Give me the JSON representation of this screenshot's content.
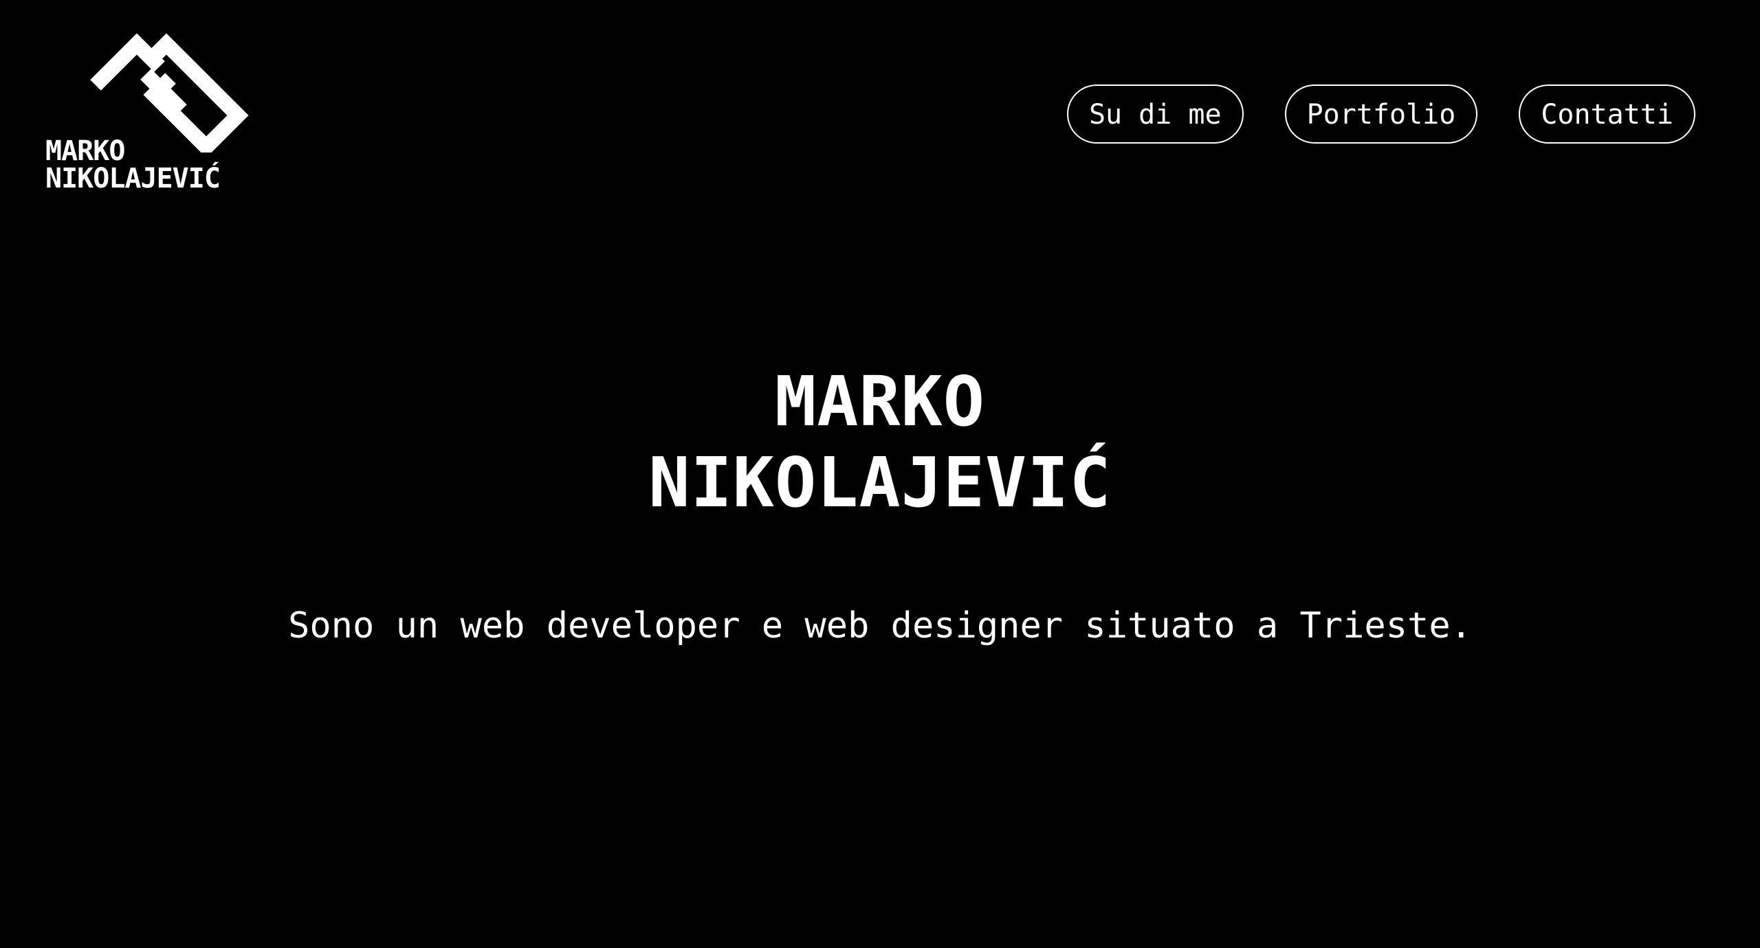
{
  "header": {
    "logo": {
      "line1": "MARKO",
      "line2": "NIKOLAJEVIĆ",
      "icon": "mn-monogram-icon"
    },
    "nav": [
      {
        "label": "Su di me"
      },
      {
        "label": "Portfolio"
      },
      {
        "label": "Contatti"
      }
    ]
  },
  "hero": {
    "title_line1": "MARKO",
    "title_line2": "NIKOLAJEVIĆ",
    "subtitle": "Sono un web developer e web designer situato a Trieste."
  },
  "colors": {
    "background": "#000000",
    "foreground": "#ffffff"
  }
}
